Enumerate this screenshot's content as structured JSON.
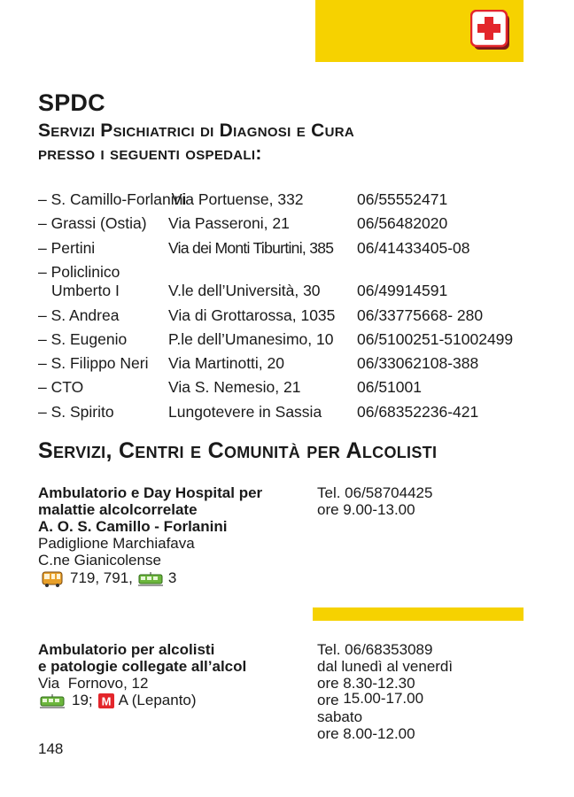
{
  "header": {
    "title": "SPDC",
    "subtitle_line1": "Servizi Psichiatrici di Diagnosi e Cura",
    "subtitle_line2": "presso i seguenti ospedali:"
  },
  "hospitals": [
    {
      "name": "– S. Camillo-Forlanini",
      "address": "Via Portuense, 332",
      "phone": "06/55552471"
    },
    {
      "name": "– Grassi (Ostia)",
      "address": "Via Passeroni, 21",
      "phone": "06/56482020"
    },
    {
      "name": "– Pertini",
      "address": "Via dei Monti Tiburtini, 385",
      "phone": "06/41433405-08"
    },
    {
      "name": "– Policlinico",
      "name2": "Umberto I",
      "address": "V.le dell’Università, 30",
      "phone": "06/49914591"
    },
    {
      "name": "– S. Andrea",
      "address": "Via di Grottarossa, 1035",
      "phone": "06/33775668- 280"
    },
    {
      "name": "– S. Eugenio",
      "address": "P.le dell’Umanesimo, 10",
      "phone": "06/5100251-51002499"
    },
    {
      "name": "– S. Filippo Neri",
      "address": "Via Martinotti, 20",
      "phone": "06/33062108-388"
    },
    {
      "name": "– CTO",
      "address": "Via S. Nemesio, 21",
      "phone": "06/51001"
    },
    {
      "name": "– S. Spirito",
      "address": "Lungotevere in Sassia",
      "phone": "06/68352236-421"
    }
  ],
  "section2_title": "Servizi, Centri e Comunità per Alcolisti",
  "entry1": {
    "bold1": "Ambulatorio e Day Hospital per",
    "bold2": "malattie alcolcorrelate",
    "bold3": "A. O. S. Camillo - Forlanini",
    "line4": "Padiglione Marchiafava",
    "line5": "C.ne Gianicolense",
    "bus_lines": "719, 791,",
    "tram_lines": "3",
    "tel": "Tel. 06/58704425",
    "hours": "ore 9.00-13.00"
  },
  "entry2": {
    "bold1": "Ambulatorio per alcolisti",
    "bold2": "e patologie collegate all’alcol",
    "address": "Via  Fornovo, 12",
    "tram_lines": "19;",
    "metro_lines": "A (Lepanto)",
    "tel": "Tel. 06/68353089",
    "days": "dal lunedì al venerdì",
    "hours1": "ore 8.30-12.30",
    "hours2_prefix": "ore",
    "hours2": "15.00-17.00",
    "saturday": "sabato",
    "saturday_hours": "ore 8.00-12.00"
  },
  "page_number": "148",
  "icons": {
    "first_aid": "first-aid-icon",
    "bus": "bus-icon",
    "tram": "tram-icon",
    "metro": "metro-icon",
    "metro_letter": "M"
  },
  "colors": {
    "accent_yellow": "#f6d200",
    "first_aid_red": "#e3262b",
    "text": "#1a1a1a"
  }
}
